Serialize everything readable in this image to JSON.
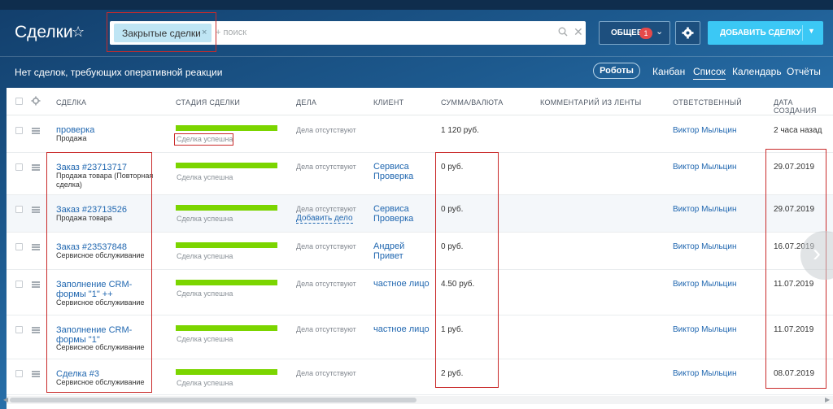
{
  "header": {
    "title": "Сделки",
    "star_glyph": "☆",
    "filter_chip": "Закрытые сделки",
    "chip_close": "×",
    "search_placeholder": "+ поиск",
    "search_clear": "✕",
    "general_btn": "ОБЩЕЕ",
    "general_badge": "1",
    "add_btn": "ДОБАВИТЬ СДЕЛКУ"
  },
  "subheader": {
    "notice": "Нет сделок, требующих оперативной реакции",
    "robots_btn": "Роботы",
    "views": [
      "Канбан",
      "Список",
      "Календарь",
      "Отчёты"
    ],
    "active_view": "Список"
  },
  "table": {
    "columns": [
      "СДЕЛКА",
      "СТАДИЯ СДЕЛКИ",
      "ДЕЛА",
      "КЛИЕНТ",
      "СУММА/ВАЛЮТА",
      "КОММЕНТАРИЙ ИЗ ЛЕНТЫ",
      "ОТВЕТСТВЕННЫЙ",
      "ДАТА СОЗДАНИЯ"
    ],
    "rows": [
      {
        "name": "проверка",
        "type": "Продажа",
        "stage": "Сделка успешна",
        "activity": "Дела отсутствуют",
        "add_activity": "",
        "client": "",
        "sum": "1 120 руб.",
        "responsible": "Виктор Мыльцин",
        "date": "2 часа назад"
      },
      {
        "name": "Заказ #23713717",
        "type": "Продажа товара (Повторная сделка)",
        "stage": "Сделка успешна",
        "activity": "Дела отсутствуют",
        "add_activity": "",
        "client": "Сервиса Проверка",
        "sum": "0 руб.",
        "responsible": "Виктор Мыльцин",
        "date": "29.07.2019"
      },
      {
        "name": "Заказ #23713526",
        "type": "Продажа товара",
        "stage": "Сделка успешна",
        "activity": "Дела отсутствуют",
        "add_activity": "Добавить дело",
        "client": "Сервиса Проверка",
        "sum": "0 руб.",
        "responsible": "Виктор Мыльцин",
        "date": "29.07.2019"
      },
      {
        "name": "Заказ #23537848",
        "type": "Сервисное обслуживание",
        "stage": "Сделка успешна",
        "activity": "Дела отсутствуют",
        "add_activity": "",
        "client": "Андрей Привет",
        "sum": "0 руб.",
        "responsible": "Виктор Мыльцин",
        "date": "16.07.2019"
      },
      {
        "name": "Заполнение CRM-формы \"1\" ++",
        "type": "Сервисное обслуживание",
        "stage": "Сделка успешна",
        "activity": "Дела отсутствуют",
        "add_activity": "",
        "client": "частное лицо",
        "sum": "4.50 руб.",
        "responsible": "Виктор Мыльцин",
        "date": "11.07.2019"
      },
      {
        "name": "Заполнение CRM-формы \"1\"",
        "type": "Сервисное обслуживание",
        "stage": "Сделка успешна",
        "activity": "Дела отсутствуют",
        "add_activity": "",
        "client": "частное лицо",
        "sum": "1 руб.",
        "responsible": "Виктор Мыльцин",
        "date": "11.07.2019"
      },
      {
        "name": "Сделка #3",
        "type": "Сервисное обслуживание",
        "stage": "Сделка успешна",
        "activity": "Дела отсутствуют",
        "add_activity": "",
        "client": "",
        "sum": "2 руб.",
        "responsible": "Виктор Мыльцин",
        "date": "08.07.2019"
      }
    ]
  },
  "colors": {
    "accent": "#3bc8f5",
    "link": "#2067b0",
    "stage_success": "#7bd500",
    "highlight": "#c92a2a"
  }
}
